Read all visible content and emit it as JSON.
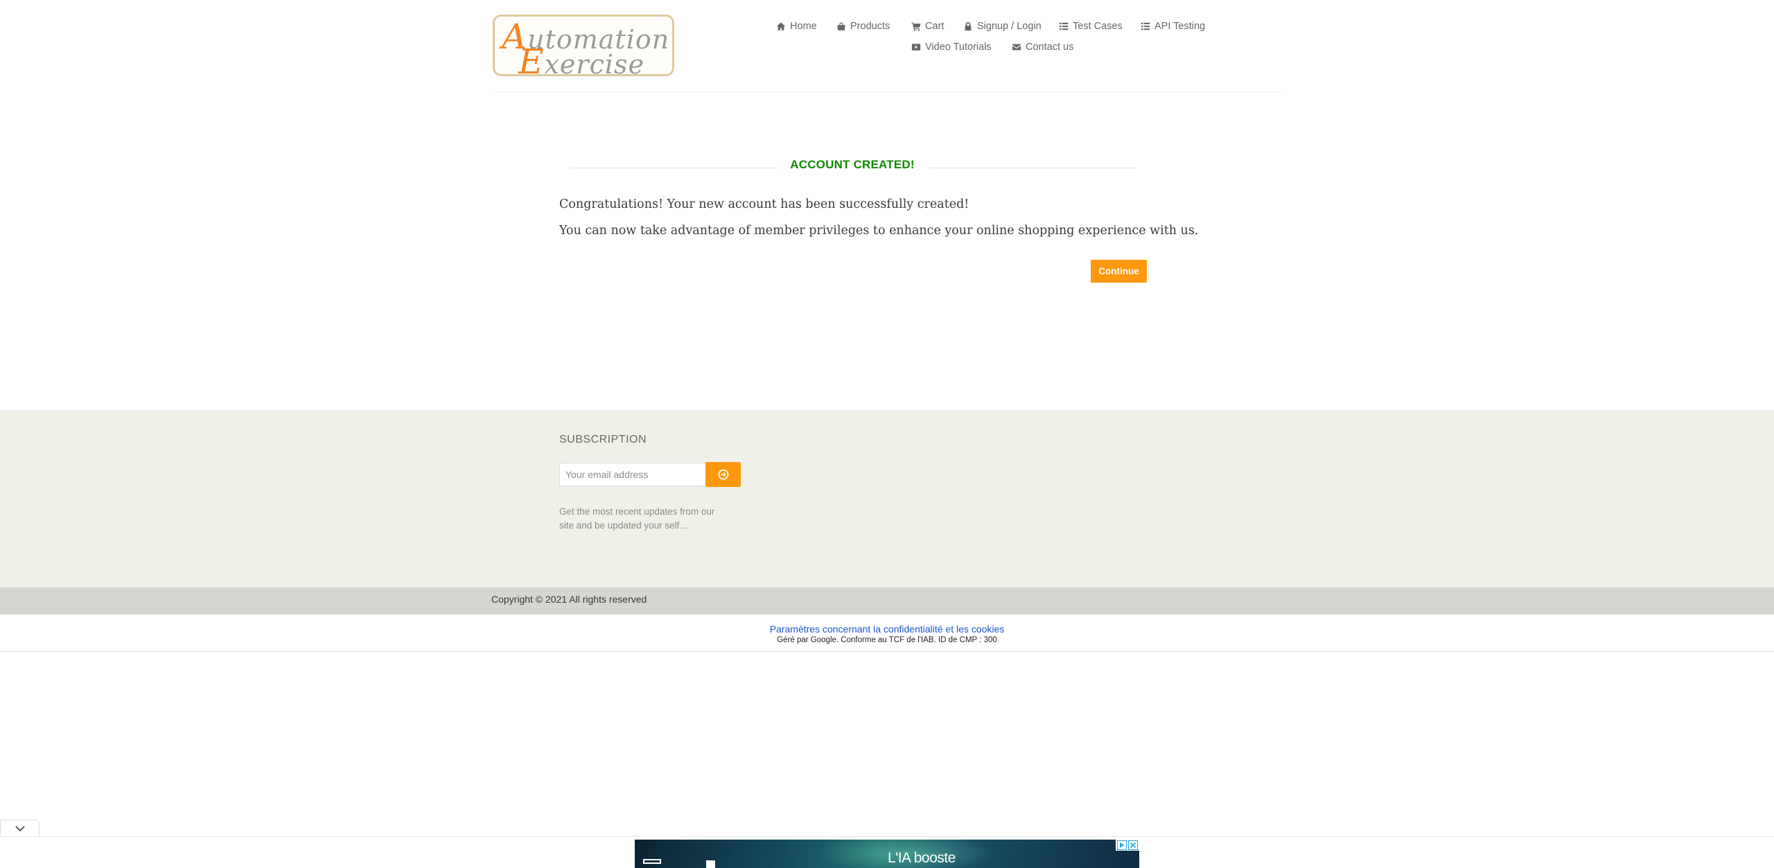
{
  "header": {
    "logo": {
      "line1": "Automation",
      "line2": "Exercise"
    },
    "nav": [
      {
        "label": "Home",
        "icon": "home-icon"
      },
      {
        "label": "Products",
        "icon": "shopping-bag-icon"
      },
      {
        "label": "Cart",
        "icon": "shopping-cart-icon"
      },
      {
        "label": "Signup / Login",
        "icon": "lock-icon"
      },
      {
        "label": "Test Cases",
        "icon": "list-icon"
      },
      {
        "label": "API Testing",
        "icon": "list-icon"
      },
      {
        "label": "Video Tutorials",
        "icon": "youtube-play-icon"
      },
      {
        "label": "Contact us",
        "icon": "envelope-icon"
      }
    ]
  },
  "main": {
    "title": "ACCOUNT CREATED!",
    "paragraphs": [
      "Congratulations! Your new account has been successfully created!",
      "You can now take advantage of member privileges to enhance your online shopping experience with us."
    ],
    "continue_label": "Continue"
  },
  "footer": {
    "subscription_title": "SUBSCRIPTION",
    "email_placeholder": "Your email address",
    "subscription_text": "Get the most recent updates from our site and be updated your self...",
    "copyright": "Copyright © 2021 All rights reserved"
  },
  "consent": {
    "link": "Paramètres concernant la confidentialité et les cookies",
    "subtext": "Géré par Google. Conforme au TCF de l'IAB. ID de CMP : 300"
  },
  "ad": {
    "headline": "L'IA booste"
  },
  "colors": {
    "accent": "#fe980f",
    "success": "#108a00",
    "footer_bg": "#f0f0e9",
    "footer_bottom_bg": "#d6d6d0",
    "link_blue": "#1a56c9"
  }
}
